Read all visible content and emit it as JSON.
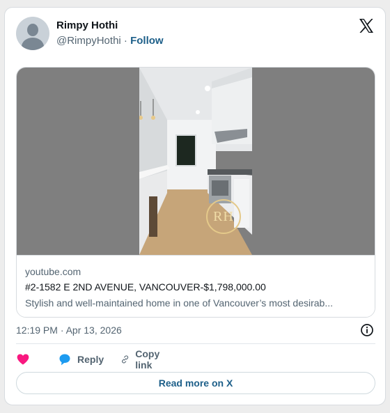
{
  "author": {
    "name": "Rimpy Hothi",
    "handle": "@RimpyHothi",
    "separator": "·",
    "follow_label": "Follow"
  },
  "logo": "x-logo-icon",
  "media": {
    "watermark": "RH",
    "domain": "youtube.com",
    "headline": "#2-1582 E 2ND AVENUE, VANCOUVER-$1,798,000.00",
    "description": "Stylish and well-maintained home in one of Vancouver’s most desirab..."
  },
  "timestamp": "12:19 PM · Apr 13, 2026",
  "actions": {
    "like_icon": "heart-icon",
    "reply_label": "Reply",
    "copy_label": "Copy link"
  },
  "read_more_label": "Read more on X",
  "colors": {
    "link": "#1d5f89",
    "heart": "#f91880",
    "reply": "#1d9bf0",
    "muted": "#536471"
  }
}
